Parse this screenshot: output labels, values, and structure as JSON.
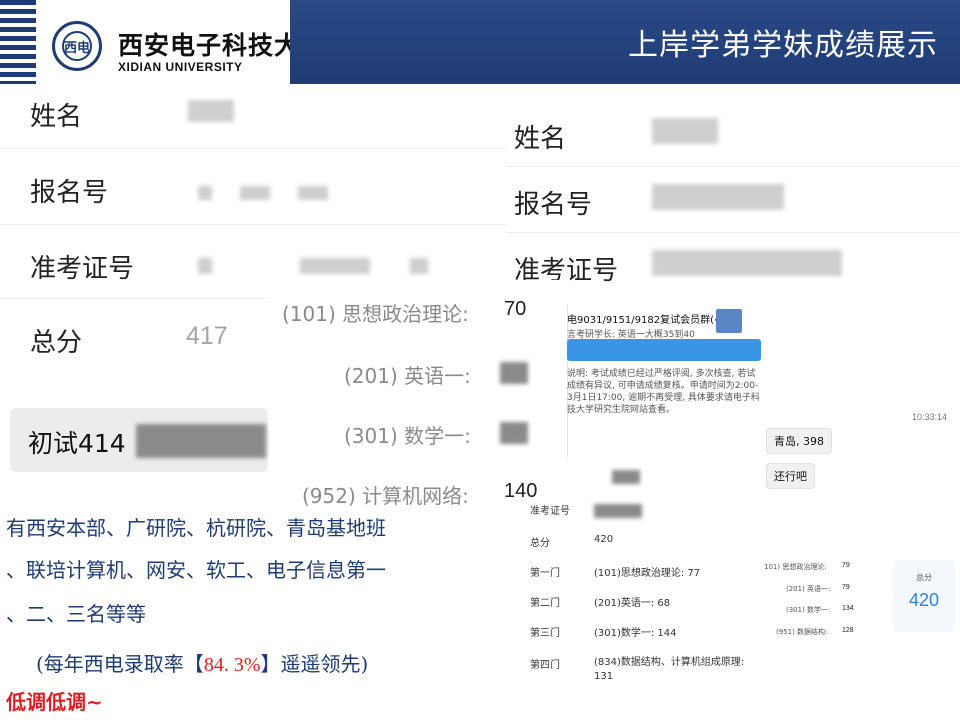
{
  "header": {
    "school_cn": "西安电子科技大学",
    "school_en": "XIDIAN UNIVERSITY",
    "seal_text": "西电",
    "title": "上岸学弟学妹成绩展示"
  },
  "left_card": {
    "name_label": "姓名",
    "reg_label": "报名号",
    "exam_label": "准考证号",
    "total_label": "总分",
    "total_value": "417"
  },
  "right_card": {
    "name_label": "姓名",
    "reg_label": "报名号",
    "exam_label": "准考证号"
  },
  "subjects": [
    {
      "label": "(101) 思想政治理论:",
      "value": "70"
    },
    {
      "label": "(201) 英语一:",
      "value": ""
    },
    {
      "label": "(301) 数学一:",
      "value": ""
    },
    {
      "label": "(952) 计算机网络:",
      "value": "140"
    }
  ],
  "bubble": {
    "text": "初试414"
  },
  "phone": {
    "title": "电9031/9151/9182复试会员群(⋯",
    "subtitle": "言考研学长: 英语一大概35到40",
    "note": "说明: 考试成绩已经过严格评阅, 多次核查, 若试成绩有异议, 可申请成绩复核。申请时间为2:00-3月1日17:00, 逾期不再受理, 具体要求请电子科技大学研究生院网站查看。"
  },
  "chat": {
    "time": "10:33:14",
    "msg1": "青岛, 398",
    "msg2": "还行吧"
  },
  "results": {
    "exam_label": "准考证号",
    "rows": [
      {
        "label": "总分",
        "value": "420"
      },
      {
        "label": "第一门",
        "value": "(101)思想政治理论: 77"
      },
      {
        "label": "第二门",
        "value": "(201)英语一: 68"
      },
      {
        "label": "第三门",
        "value": "(301)数学一: 144"
      },
      {
        "label": "第四门",
        "value": "(834)数据结构、计算机组成原理: 131"
      }
    ],
    "small": [
      {
        "label": "101) 思想政治理论:",
        "value": "79"
      },
      {
        "label": "(201) 英语一:",
        "value": "79"
      },
      {
        "label": "(301) 数学一:",
        "value": "134"
      },
      {
        "label": "(951) 数据结构:",
        "value": "128"
      }
    ],
    "total_label": "总分",
    "total_value": "420"
  },
  "text_block": {
    "line1": "有西安本部、广研院、杭研院、青岛基地班",
    "line2": "、联培计算机、网安、软工、电子信息第一",
    "line3": "、二、三名等等",
    "note_prefix": "(每年西电录取率【",
    "note_pct": "84. 3%",
    "note_suffix": "】遥遥领先)",
    "lowkey": "低调低调~"
  }
}
